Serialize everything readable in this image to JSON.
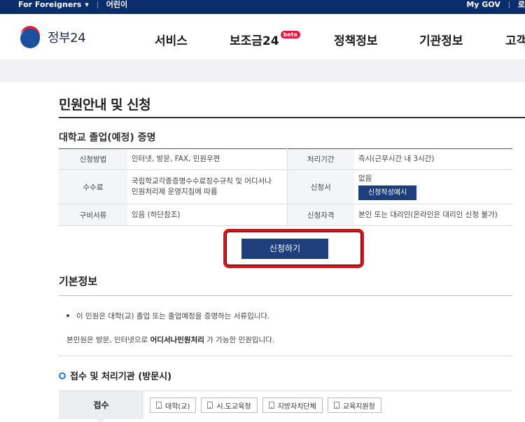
{
  "topbar": {
    "foreigners": "For Foreigners",
    "kids": "어린이",
    "mygov": "My GOV",
    "right_partial": "로"
  },
  "header": {
    "logo_text": "정부24",
    "nav": [
      "서비스",
      "보조금24",
      "정책정보",
      "기관정보",
      "고객"
    ],
    "beta_badge": "beta"
  },
  "page": {
    "title": "민원안내 및 신청",
    "subtitle": "대학교 졸업(예정) 증명"
  },
  "info_table": {
    "rows": [
      {
        "label1": "신청방법",
        "value1": "인터넷, 방문, FAX, 민원우편",
        "label2": "처리기간",
        "value2": "즉시(근무시간 내 3시간)"
      },
      {
        "label1": "수수료",
        "value1_line1": "국립학교각종증명수수료징수규칙 및 어디서나",
        "value1_line2": "민원처리제 운영지침에 따름",
        "label2": "신청서",
        "value2": "없음",
        "value2_button": "신청작성예시"
      },
      {
        "label1": "구비서류",
        "value1": "있음 (하단참조)",
        "label2": "신청자격",
        "value2": "본인 또는 대리인(온라인은 대리인 신청 불가)"
      }
    ]
  },
  "apply_button": "신청하기",
  "basic_info": {
    "title": "기본정보",
    "bullet": "이 민원은 대학(교) 졸업 또는 졸업예정을 증명하는 서류입니다.",
    "line_prefix": "본민원은 방문, 인터넷으로 ",
    "line_bold": "어디서나민원처리",
    "line_suffix": " 가 가능한 민원입니다."
  },
  "agency_section": {
    "title": "접수 및 처리기관 (방문시)",
    "tab_label": "접수",
    "chips": [
      "대학(교)",
      "시.도교육청",
      "지방자치단체",
      "교육지원청"
    ]
  },
  "colors": {
    "topbar": "#0b2d6b",
    "primary_button": "#1f3e7c",
    "highlight_outline": "#d8121a",
    "accent_ring": "#1d78d4"
  }
}
